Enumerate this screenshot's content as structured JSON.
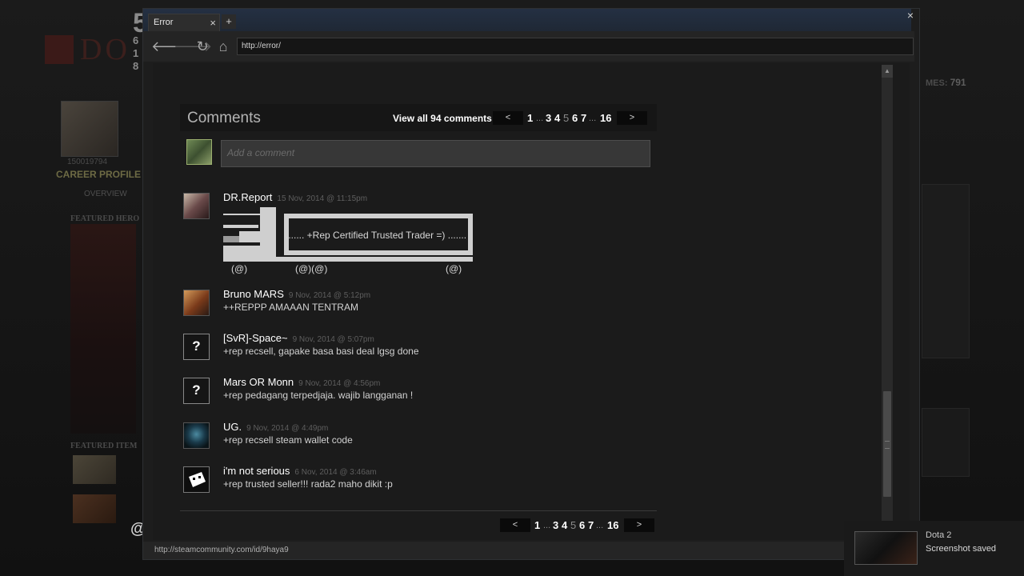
{
  "background": {
    "big_number": "5",
    "side_numbers": [
      "6",
      "1",
      "8"
    ],
    "logo_text": "DO",
    "account_id": "150019794",
    "career_profile": "CAREER PROFILE",
    "overview": "OVERVIEW",
    "featured_heroes": "FEATURED HERO",
    "featured_items": "FEATURED ITEM",
    "games_label": "MES:",
    "games_count": "791",
    "at_symbol": "@"
  },
  "browser": {
    "tab_title": "Error",
    "tab_close": "×",
    "new_tab": "+",
    "window_close": "×",
    "url": "http://error/",
    "status_url": "http://steamcommunity.com/id/9haya9",
    "nav": {
      "back": "🡐",
      "forward": "🡒",
      "reload": "↻",
      "home": "⌂"
    }
  },
  "comments": {
    "title": "Comments",
    "view_all": "View all 94 comments",
    "input_placeholder": "Add a comment",
    "pager": {
      "prev": "<",
      "next": ">",
      "first": "1",
      "ellipsis": "...",
      "pages": [
        "3",
        "4",
        "5",
        "6",
        "7"
      ],
      "current": "5",
      "last": "16"
    },
    "items": [
      {
        "author": "DR.Report",
        "time": "15 Nov, 2014 @ 11:15pm",
        "text": "....... +Rep Certified Trusted Trader =) .......",
        "art_wheels": "(@)          (@)(@)                              (@)"
      },
      {
        "author": "Bruno MARS",
        "time": "9 Nov, 2014 @ 5:12pm",
        "text": "++REPPP AMAAAN TENTRAM"
      },
      {
        "author": "[SvR]-Space~",
        "time": "9 Nov, 2014 @ 5:07pm",
        "text": "+rep recsell, gapake basa basi deal lgsg done"
      },
      {
        "author": "Mars OR Monn",
        "time": "9 Nov, 2014 @ 4:56pm",
        "text": "+rep pedagang terpedjaja. wajib langganan !"
      },
      {
        "author": "UG.",
        "time": "9 Nov, 2014 @ 4:49pm",
        "text": "+rep recsell steam wallet code"
      },
      {
        "author": "i'm not serious",
        "time": "6 Nov, 2014 @ 3:46am",
        "text": "+rep trusted seller!!! rada2 maho dikit :p"
      }
    ],
    "unknown_avatar_glyph": "?"
  },
  "toast": {
    "app": "Dota 2",
    "message": "Screenshot saved"
  }
}
